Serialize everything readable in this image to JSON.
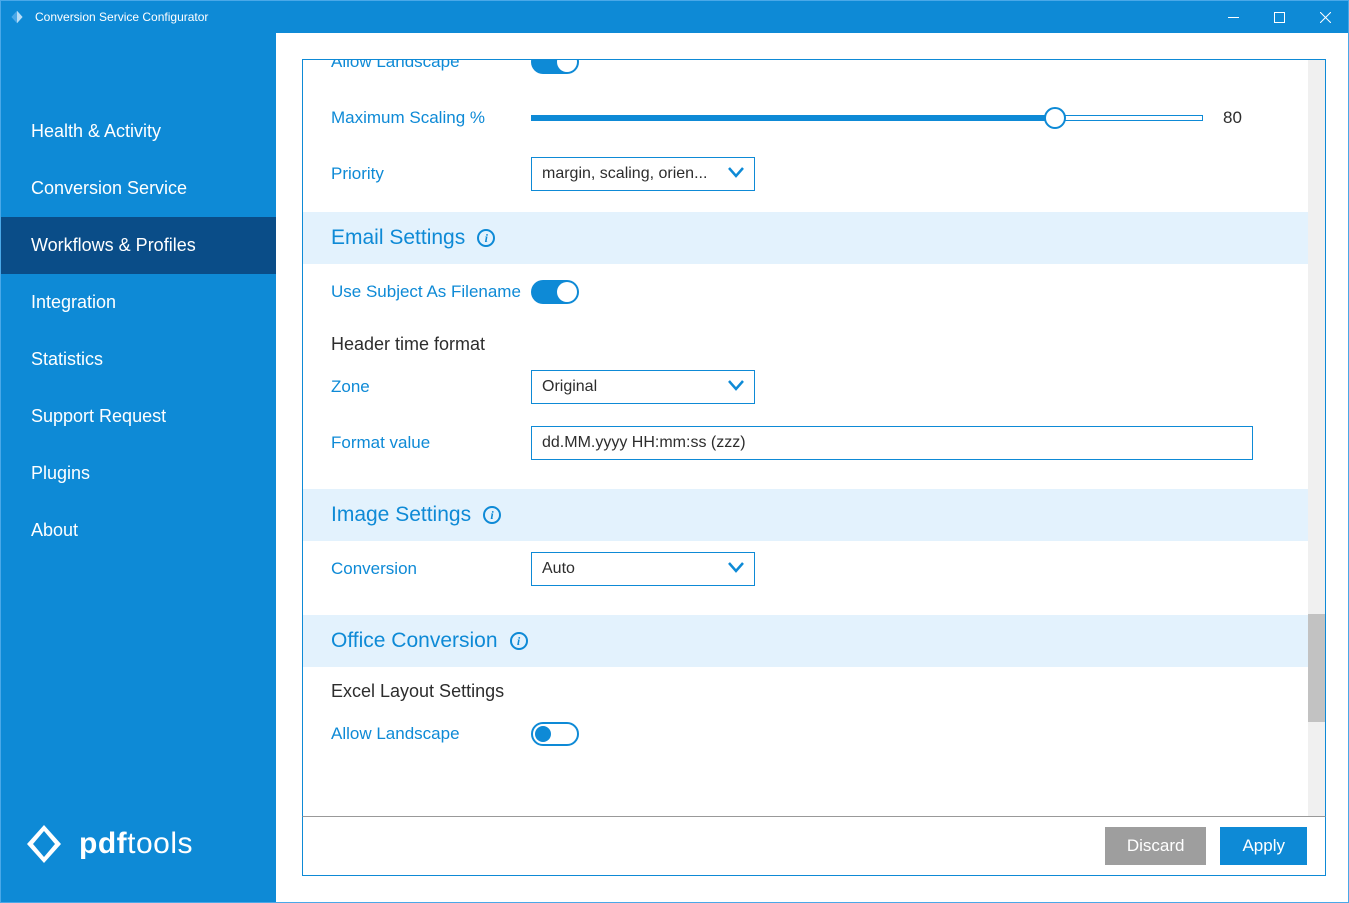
{
  "titlebar": {
    "title": "Conversion Service Configurator"
  },
  "sidebar": {
    "items": [
      {
        "label": "Health & Activity"
      },
      {
        "label": "Conversion Service"
      },
      {
        "label": "Workflows & Profiles"
      },
      {
        "label": "Integration"
      },
      {
        "label": "Statistics"
      },
      {
        "label": "Support Request"
      },
      {
        "label": "Plugins"
      },
      {
        "label": "About"
      }
    ],
    "brand_prefix": "pdf",
    "brand_suffix": "tools"
  },
  "form": {
    "allow_landscape_top": "Allow Landscape",
    "max_scaling": {
      "label": "Maximum Scaling %",
      "value": "80"
    },
    "priority": {
      "label": "Priority",
      "value": "margin, scaling, orien..."
    },
    "email_section": "Email Settings",
    "use_subject": "Use Subject As Filename",
    "header_time_format": "Header time format",
    "zone": {
      "label": "Zone",
      "value": "Original"
    },
    "format_value": {
      "label": "Format value",
      "value": "dd.MM.yyyy HH:mm:ss (zzz)"
    },
    "image_section": "Image Settings",
    "conversion": {
      "label": "Conversion",
      "value": "Auto"
    },
    "office_section": "Office Conversion",
    "excel_layout": "Excel Layout Settings",
    "allow_landscape": "Allow Landscape"
  },
  "footer": {
    "discard": "Discard",
    "apply": "Apply"
  }
}
